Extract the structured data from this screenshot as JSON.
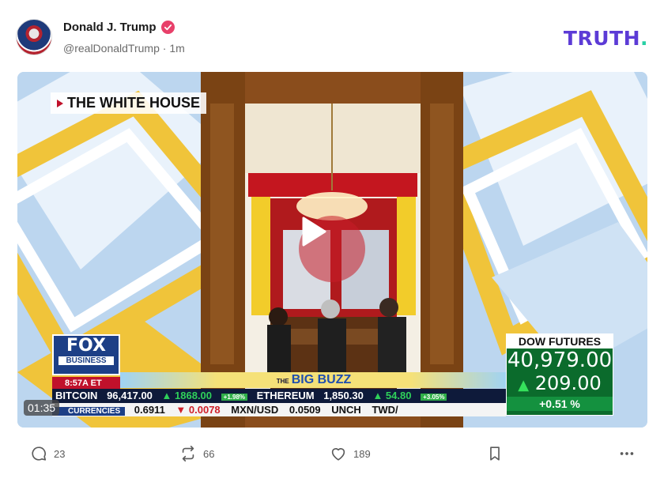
{
  "post": {
    "author_name": "Donald J. Trump",
    "handle": "@realDonaldTrump",
    "separator": "·",
    "time": "1m",
    "brand": "TRUTH",
    "brand_dot": "."
  },
  "video": {
    "duration": "01:35",
    "label": "THE WHITE HOUSE",
    "network": "FOX",
    "network_sub": "BUSINESS",
    "clock": "8:57A ET",
    "segment_prefix": "THE",
    "segment": "BIG BUZZ",
    "ticker_top": {
      "bitcoin_label": "BITCOIN",
      "bitcoin_value": "96,417.00",
      "bitcoin_change": "▲ 1868.00",
      "bitcoin_pct": "+1.98%",
      "eth_label": "ETHEREUM",
      "eth_value": "1,850.30",
      "eth_change": "▲ 54.80",
      "eth_pct": "+3.05%"
    },
    "ticker_bottom": {
      "currencies_label": "CURRENCIES",
      "v1": "0.6911",
      "v1_change": "▼ 0.0078",
      "pair": "MXN/USD",
      "pair_value": "0.0509",
      "pair_status": "UNCH",
      "pair2": "TWD/"
    },
    "dow": {
      "title": "DOW FUTURES",
      "value": "40,979.00",
      "change": "209.00",
      "change_arrow": "▲",
      "pct": "+0.51 %"
    }
  },
  "actions": {
    "replies": "23",
    "retruths": "66",
    "likes": "189"
  },
  "colors": {
    "brand": "#5c3bd6",
    "brand_dot": "#27d0a4",
    "verified": "#e8406a"
  },
  "icons": [
    "verified-icon",
    "play-icon",
    "reply-icon",
    "retruth-icon",
    "like-icon",
    "bookmark-icon",
    "more-icon"
  ]
}
